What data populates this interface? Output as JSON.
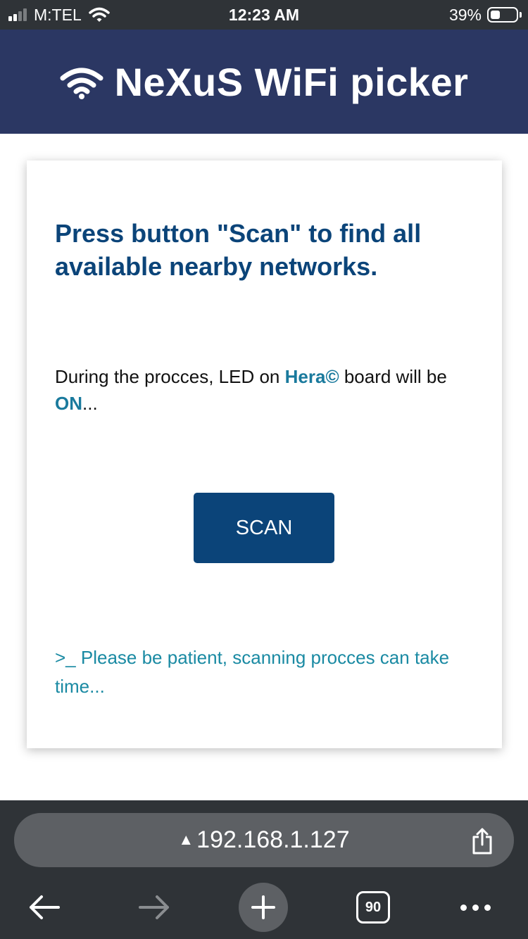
{
  "status_bar": {
    "carrier": "M:TEL",
    "time": "12:23 AM",
    "battery_percent": "39%",
    "battery_level": 0.39,
    "signal_bars_active": 2,
    "signal_bars_total": 4,
    "icons": [
      "signal-icon",
      "wifi-icon",
      "battery-icon"
    ]
  },
  "header": {
    "title": "NeXuS WiFi picker",
    "logo_icon": "wifi-icon",
    "background": "#2b3763"
  },
  "card": {
    "heading": "Press button \"Scan\" to find all available nearby networks.",
    "description": {
      "part1": "During the procces, LED on ",
      "board": "Hera©",
      "part2": " board will be ",
      "state": "ON",
      "part3": "..."
    },
    "scan_button_label": "SCAN",
    "note": ">_ Please be patient, scanning procces can take time..."
  },
  "browser": {
    "url": "192.168.1.127",
    "url_warning_icon": "warning-icon",
    "tab_count": "90",
    "icons": [
      "back-icon",
      "forward-icon",
      "plus-icon",
      "tabs-icon",
      "more-icon",
      "share-icon"
    ]
  },
  "colors": {
    "header_bg": "#2b3763",
    "heading_text": "#0b4479",
    "button_bg": "#0b4479",
    "highlight": "#1a7a9d",
    "note_text": "#1a8aa3",
    "chrome_bg": "#2f3337"
  }
}
